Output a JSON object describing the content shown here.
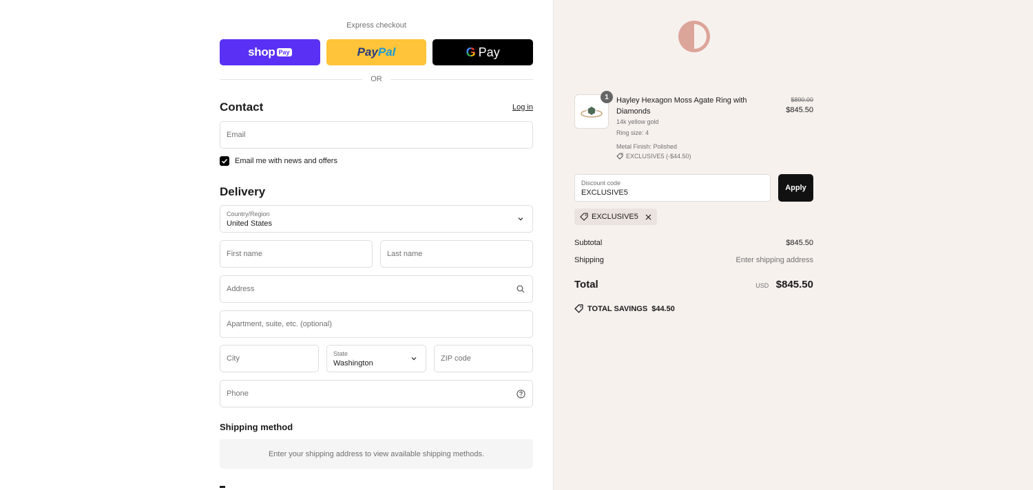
{
  "express": {
    "title": "Express checkout",
    "shop_pay": {
      "brand": "shop",
      "badge": "Pay"
    },
    "paypal": {
      "part1": "Pay",
      "part2": "Pal"
    },
    "gpay": {
      "g": "G",
      "label": "Pay"
    },
    "or_text": "OR"
  },
  "contact": {
    "title": "Contact",
    "login_link": "Log in",
    "email_placeholder": "Email",
    "newsletter_label": "Email me with news and offers",
    "newsletter_checked": true
  },
  "delivery": {
    "title": "Delivery",
    "country_label": "Country/Region",
    "country_value": "United States",
    "first_name_placeholder": "First name",
    "last_name_placeholder": "Last name",
    "address_placeholder": "Address",
    "apartment_placeholder": "Apartment, suite, etc. (optional)",
    "city_placeholder": "City",
    "state_label": "State",
    "state_value": "Washington",
    "zip_placeholder": "ZIP code",
    "phone_placeholder": "Phone"
  },
  "shipping_method": {
    "title": "Shipping method",
    "message": "Enter your shipping address to view available shipping methods."
  },
  "summary": {
    "item": {
      "quantity": "1",
      "name": "Hayley Hexagon Moss Agate Ring with Diamonds",
      "variant": "14k yellow gold",
      "ring_size": "Ring size: 4",
      "finish": "Metal Finish: Polished",
      "discount": "EXCLUSIVE5 (-$44.50)",
      "price_original": "$890.00",
      "price_final": "$845.50"
    },
    "discount_label": "Discount code",
    "discount_value": "EXCLUSIVE5",
    "apply_label": "Apply",
    "applied_code": "EXCLUSIVE5",
    "subtotal_label": "Subtotal",
    "subtotal_value": "$845.50",
    "shipping_label": "Shipping",
    "shipping_value": "Enter shipping address",
    "total_label": "Total",
    "total_currency": "USD",
    "total_value": "$845.50",
    "savings_label": "TOTAL SAVINGS",
    "savings_value": "$44.50"
  },
  "colors": {
    "shop_pay": "#5a31f4",
    "paypal": "#ffc439",
    "logo": "#dca59a",
    "summary_bg": "#f7f1ee"
  }
}
